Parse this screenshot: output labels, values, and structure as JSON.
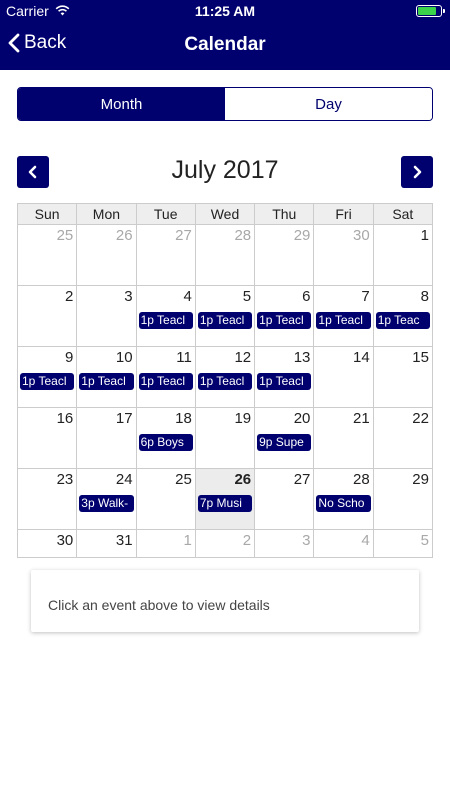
{
  "status_bar": {
    "carrier": "Carrier",
    "time": "11:25 AM"
  },
  "nav": {
    "back_label": "Back",
    "title": "Calendar"
  },
  "segments": {
    "month": "Month",
    "day": "Day"
  },
  "calendar": {
    "month_title": "July 2017",
    "weekdays": [
      "Sun",
      "Mon",
      "Tue",
      "Wed",
      "Thu",
      "Fri",
      "Sat"
    ],
    "weeks": [
      [
        {
          "n": "25",
          "other": true
        },
        {
          "n": "26",
          "other": true
        },
        {
          "n": "27",
          "other": true
        },
        {
          "n": "28",
          "other": true
        },
        {
          "n": "29",
          "other": true
        },
        {
          "n": "30",
          "other": true
        },
        {
          "n": "1"
        }
      ],
      [
        {
          "n": "2"
        },
        {
          "n": "3"
        },
        {
          "n": "4",
          "event": "1p Teacl"
        },
        {
          "n": "5",
          "event": "1p Teacl"
        },
        {
          "n": "6",
          "event": "1p Teacl"
        },
        {
          "n": "7",
          "event": "1p Teacl"
        },
        {
          "n": "8",
          "event": "1p Teac"
        }
      ],
      [
        {
          "n": "9",
          "event": "1p Teacl"
        },
        {
          "n": "10",
          "event": "1p Teacl"
        },
        {
          "n": "11",
          "event": "1p Teacl"
        },
        {
          "n": "12",
          "event": "1p Teacl"
        },
        {
          "n": "13",
          "event": "1p Teacl"
        },
        {
          "n": "14"
        },
        {
          "n": "15"
        }
      ],
      [
        {
          "n": "16"
        },
        {
          "n": "17"
        },
        {
          "n": "18",
          "event": "6p Boys"
        },
        {
          "n": "19"
        },
        {
          "n": "20",
          "event": "9p Supe"
        },
        {
          "n": "21"
        },
        {
          "n": "22"
        }
      ],
      [
        {
          "n": "23"
        },
        {
          "n": "24",
          "event": "3p Walk-"
        },
        {
          "n": "25"
        },
        {
          "n": "26",
          "today": true,
          "event": "7p Musi"
        },
        {
          "n": "27"
        },
        {
          "n": "28",
          "event": "No Scho"
        },
        {
          "n": "29"
        }
      ],
      [
        {
          "n": "30"
        },
        {
          "n": "31"
        },
        {
          "n": "1",
          "other": true
        },
        {
          "n": "2",
          "other": true
        },
        {
          "n": "3",
          "other": true
        },
        {
          "n": "4",
          "other": true
        },
        {
          "n": "5",
          "other": true
        }
      ]
    ]
  },
  "details": {
    "placeholder": "Click an event above to view details"
  },
  "colors": {
    "primary": "#00006e",
    "today_bg": "#ececec",
    "battery": "#3bd34a"
  }
}
